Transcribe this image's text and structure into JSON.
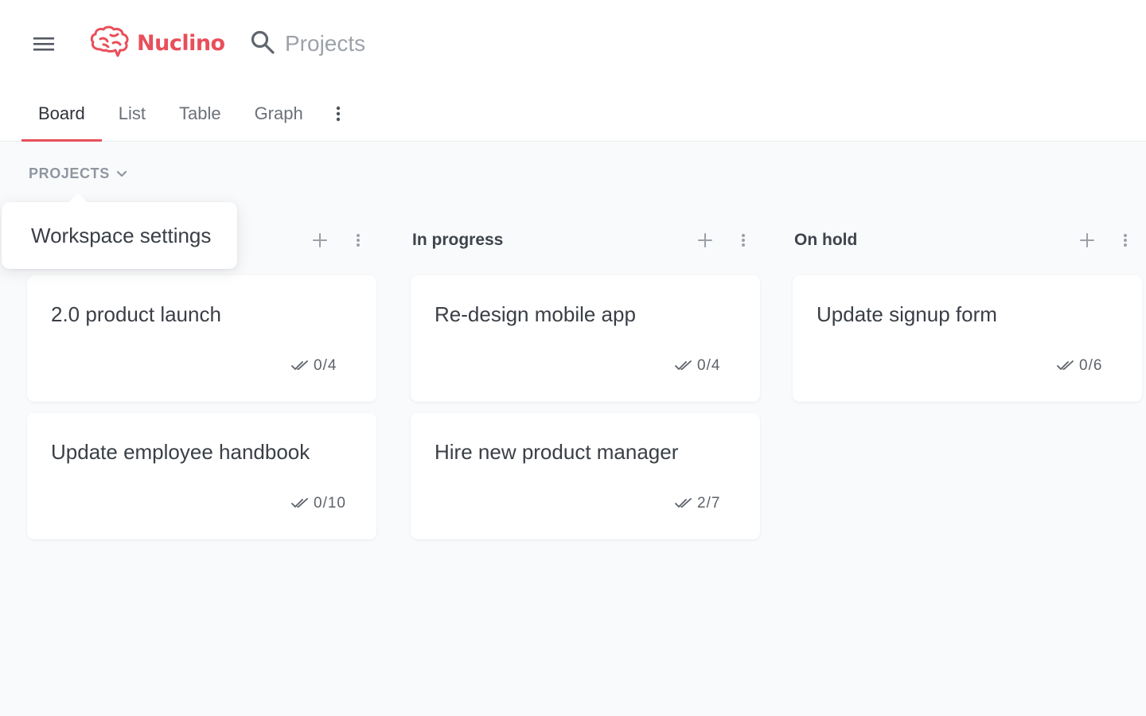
{
  "app": {
    "brand": "Nuclino",
    "brand_color": "#e84f5a",
    "menu_icon": "hamburger-menu-icon",
    "logo_icon": "brain-logo-icon"
  },
  "search": {
    "icon": "search-icon",
    "text": "Projects"
  },
  "tabs": [
    {
      "label": "Board",
      "active": true
    },
    {
      "label": "List",
      "active": false
    },
    {
      "label": "Table",
      "active": false
    },
    {
      "label": "Graph",
      "active": false
    }
  ],
  "tabs_more_icon": "vertical-dots-icon",
  "section": {
    "label": "PROJECTS",
    "icon": "chevron-down-icon"
  },
  "popover": {
    "label": "Workspace settings"
  },
  "columns": [
    {
      "title": "",
      "cards": [
        {
          "title": "2.0 product launch",
          "progress": "0/4"
        },
        {
          "title": "Update employee handbook",
          "progress": "0/10"
        }
      ]
    },
    {
      "title": "In progress",
      "cards": [
        {
          "title": "Re-design mobile app",
          "progress": "0/4"
        },
        {
          "title": "Hire new product manager",
          "progress": "2/7"
        }
      ]
    },
    {
      "title": "On hold",
      "cards": [
        {
          "title": "Update signup form",
          "progress": "0/6"
        }
      ]
    }
  ],
  "column_icons": {
    "add": "plus-icon",
    "more": "vertical-dots-icon",
    "progress": "double-check-icon"
  }
}
